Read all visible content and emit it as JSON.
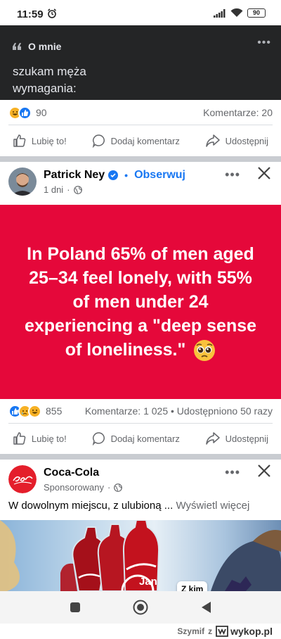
{
  "status_bar": {
    "time": "11:59",
    "battery": "90"
  },
  "post1": {
    "about_heading": "O mnie",
    "about_text_line1": "szukam męża",
    "about_text_line2": "wymagania:",
    "reaction_count": "90",
    "comments": "Komentarze: 20"
  },
  "actions": {
    "like": "Lubię to!",
    "comment": "Dodaj komentarz",
    "share": "Udostępnij"
  },
  "post2": {
    "author": "Patrick Ney",
    "follow": "Obserwuj",
    "time": "1 dni",
    "quote": "In Poland 65% of men aged 25–34 feel lonely, with 55% of men under 24 experiencing a \"deep sense of loneliness.\"",
    "reaction_count": "855",
    "stats": "Komentarze: 1 025 • Udostępniono 50 razy"
  },
  "post3": {
    "author": "Coca-Cola",
    "meta": "Sponsorowany",
    "ad_text": "W dowolnym miejscu, z ulubioną ...",
    "see_more": "Wyświetl więcej",
    "bottle_label": "Jan",
    "sticker": "Z kim"
  },
  "watermark": {
    "user": "Szymif",
    "connector": "z",
    "site": "wykop.pl"
  },
  "colors": {
    "facebook_blue": "#1877f2",
    "quote_bg": "#e5083a",
    "coca_cola_red": "#e41e2b"
  }
}
